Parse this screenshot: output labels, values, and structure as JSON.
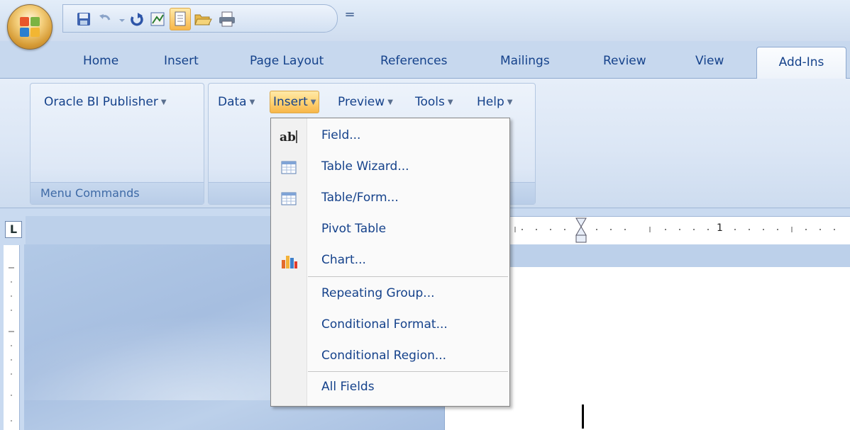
{
  "quick_access": {
    "icons": [
      "save-icon",
      "undo-icon",
      "redo-icon",
      "report-icon",
      "page-icon",
      "open-icon",
      "print-icon"
    ],
    "more_glyph": "="
  },
  "tabs": [
    {
      "label": "Home"
    },
    {
      "label": "Insert"
    },
    {
      "label": "Page Layout"
    },
    {
      "label": "References"
    },
    {
      "label": "Mailings"
    },
    {
      "label": "Review"
    },
    {
      "label": "View"
    },
    {
      "label": "Add-Ins",
      "active": true
    }
  ],
  "ribbon": {
    "group1": {
      "button": "Oracle BI Publisher",
      "label": "Menu Commands"
    },
    "group2": {
      "buttons": [
        "Data",
        "Insert",
        "Preview",
        "Tools",
        "Help"
      ]
    }
  },
  "ruler": {
    "corner": "L",
    "mark": "1"
  },
  "insert_menu": {
    "items": [
      {
        "label": "Field...",
        "icon": "ab-field-icon"
      },
      {
        "label": "Table Wizard...",
        "icon": "table-icon"
      },
      {
        "label": "Table/Form...",
        "icon": "table-icon"
      },
      {
        "label": "Pivot Table",
        "icon": ""
      },
      {
        "label": "Chart...",
        "icon": "chart-icon"
      },
      {
        "label": "Repeating Group...",
        "icon": ""
      },
      {
        "label": "Conditional Format...",
        "icon": ""
      },
      {
        "label": "Conditional Region...",
        "icon": ""
      },
      {
        "label": "All Fields",
        "icon": ""
      }
    ]
  },
  "colors": {
    "text_blue": "#15428b",
    "ribbon_bg": "#dbe6f5",
    "insert_highlight": "#ffd67a"
  }
}
